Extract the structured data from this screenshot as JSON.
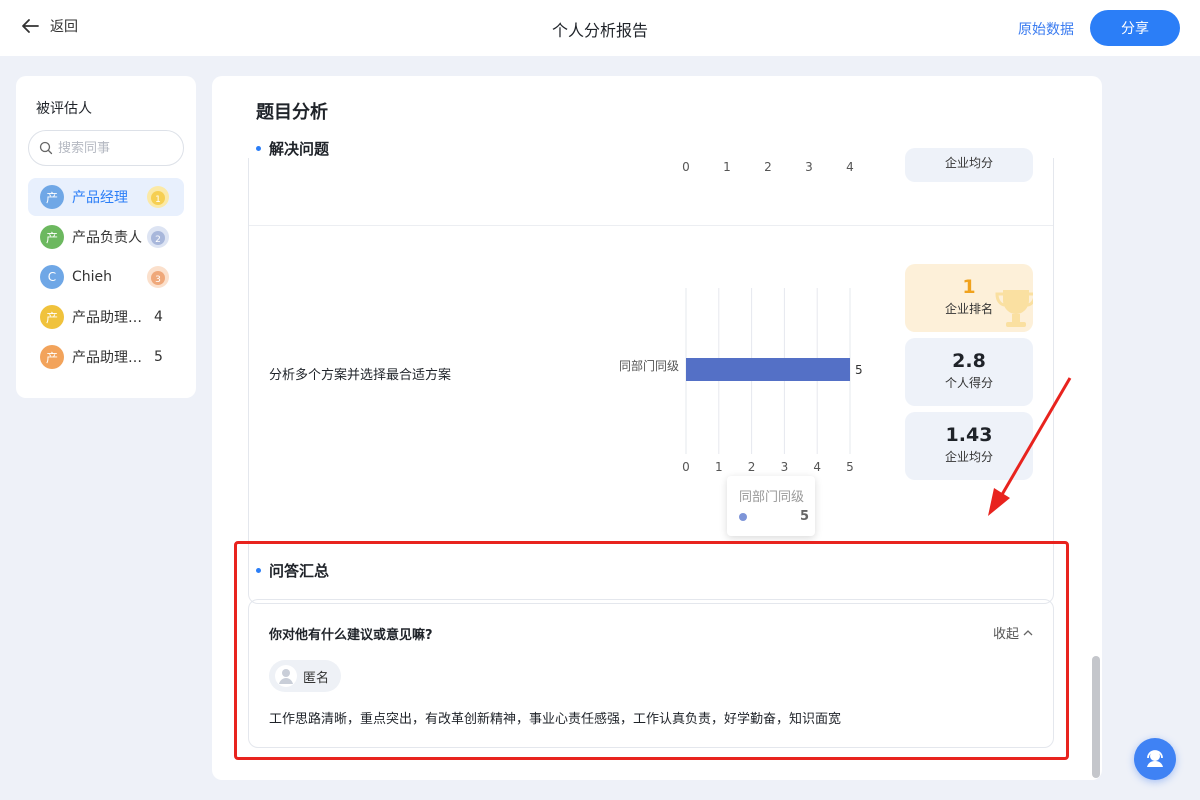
{
  "header": {
    "back_label": "返回",
    "title": "个人分析报告",
    "raw_data_label": "原始数据",
    "share_label": "分享"
  },
  "sidebar": {
    "title": "被评估人",
    "search_placeholder": "搜索同事",
    "people": [
      {
        "avatar": "产",
        "name": "产品经理",
        "rank": "1",
        "color": "#6fa7e6",
        "medal": "gold"
      },
      {
        "avatar": "产",
        "name": "产品负责人",
        "rank": "2",
        "color": "#6cb85f",
        "medal": "silver"
      },
      {
        "avatar": "C",
        "name": "Chieh",
        "rank": "3",
        "color": "#6fa7e6",
        "medal": "bronze"
      },
      {
        "avatar": "产",
        "name": "产品助理…",
        "rank": "4",
        "color": "#f0c23c"
      },
      {
        "avatar": "产",
        "name": "产品助理…",
        "rank": "5",
        "color": "#f2a35b"
      }
    ]
  },
  "main": {
    "section_title": "题目分析",
    "subsection1": "解决问题",
    "top_row": {
      "ticks": [
        "0",
        "1",
        "2",
        "3",
        "4"
      ],
      "stat_label": "企业均分"
    },
    "question": {
      "text": "分析多个方案并选择最合适方案",
      "chart_ticks": [
        "0",
        "1",
        "2",
        "3",
        "4",
        "5"
      ],
      "tooltip_title": "同部门同级",
      "tooltip_value": "5",
      "stats": [
        {
          "value": "1",
          "label": "企业排名"
        },
        {
          "value": "2.8",
          "label": "个人得分"
        },
        {
          "value": "1.43",
          "label": "企业均分"
        }
      ]
    },
    "subsection2": "问答汇总",
    "qa": {
      "question": "你对他有什么建议或意见嘛?",
      "collapse_label": "收起",
      "respondent": "匿名",
      "answer": "工作思路清晰，重点突出，有改革创新精神，事业心责任感强，工作认真负责，好学勤奋，知识面宽"
    }
  },
  "chart_data": {
    "type": "bar",
    "categories": [
      "同部门同级"
    ],
    "values": [
      5
    ],
    "xlim": [
      0,
      5
    ],
    "orientation": "horizontal",
    "color": "#5470c6"
  }
}
